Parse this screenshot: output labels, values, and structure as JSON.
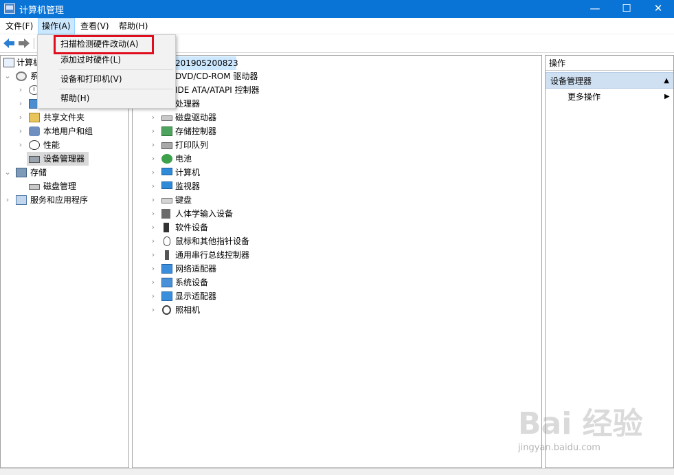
{
  "window": {
    "title": "计算机管理",
    "controls": {
      "minimize": "—",
      "maximize": "☐",
      "close": "✕"
    }
  },
  "menu": {
    "items": [
      "文件(F)",
      "操作(A)",
      "查看(V)",
      "帮助(H)"
    ],
    "active": "操作(A)",
    "dropdown": [
      "扫描检测硬件改动(A)",
      "添加过时硬件(L)",
      "设备和打印机(V)",
      "帮助(H)"
    ],
    "highlighted_item": "扫描检测硬件改动(A)"
  },
  "tree": {
    "root": "计算机",
    "system_group": "系",
    "items": [
      "共享文件夹",
      "本地用户和组",
      "性能",
      "设备管理器"
    ],
    "storage": "存储",
    "disk_management": "磁盘管理",
    "services": "服务和应用程序"
  },
  "device_list": {
    "computer_name": "201905200823",
    "categories": [
      "DVD/CD-ROM 驱动器",
      "IDE ATA/ATAPI 控制器",
      "处理器",
      "磁盘驱动器",
      "存储控制器",
      "打印队列",
      "电池",
      "计算机",
      "监视器",
      "键盘",
      "人体学输入设备",
      "软件设备",
      "鼠标和其他指针设备",
      "通用串行总线控制器",
      "网络适配器",
      "系统设备",
      "显示适配器",
      "照相机"
    ]
  },
  "actions": {
    "header": "操作",
    "section": "设备管理器",
    "more": "更多操作"
  },
  "watermark": {
    "logo": "Bai 经验",
    "url": "jingyan.baidu.com"
  },
  "colors": {
    "titlebar": "#0a74d6",
    "menu_active": "#cce8ff",
    "action_section": "#cfe0f3",
    "highlight_box": "#e00d1e"
  }
}
